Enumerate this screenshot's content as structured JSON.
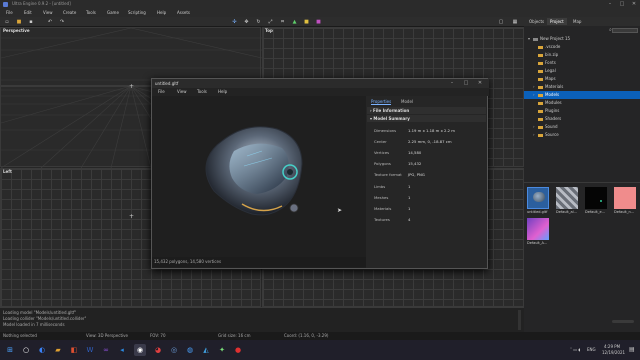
{
  "app": {
    "title": "Ultra Engine 0.9.2 - [untitled]"
  },
  "menu": [
    "File",
    "Edit",
    "View",
    "Create",
    "Tools",
    "Game",
    "Scripting",
    "Help",
    "Assets"
  ],
  "viewports": {
    "perspective": "Perspective",
    "top": "Top",
    "left": "Left"
  },
  "console": {
    "lines": [
      "Loading model \"Models/untitled.gltf\"",
      "Loading collider \"Models/untitled.collider\"",
      "Model loaded in 7 milliseconds"
    ]
  },
  "statusbar": {
    "selection": "Nothing selected",
    "view": "View: 3D Perspective",
    "fov": "FOV: 70",
    "grid": "Grid size: 16 cm",
    "coords": "Coord: (1.16, 0, -3.29)"
  },
  "right_panel": {
    "tabs": [
      "Objects",
      "Project",
      "Map"
    ],
    "active_tab": "Project",
    "tree": [
      {
        "label": "New Project 15",
        "expanded": true,
        "level": 0
      },
      {
        "label": ".vscode",
        "level": 1
      },
      {
        "label": "bin.zip",
        "level": 1
      },
      {
        "label": "Fonts",
        "level": 1
      },
      {
        "label": "Legal",
        "level": 1
      },
      {
        "label": "Maps",
        "level": 1
      },
      {
        "label": "Materials",
        "level": 1,
        "arrow": true
      },
      {
        "label": "Models",
        "level": 1,
        "arrow": true,
        "selected": true
      },
      {
        "label": "Modules",
        "level": 1
      },
      {
        "label": "Plugins",
        "level": 1
      },
      {
        "label": "Shaders",
        "level": 1
      },
      {
        "label": "Sound",
        "level": 1,
        "arrow": true
      },
      {
        "label": "Source",
        "level": 1,
        "arrow": true
      }
    ],
    "assets": [
      {
        "label": "untitled.gltf",
        "color": "#2b5f9e",
        "selected": true
      },
      {
        "label": "Default_al...",
        "color": "#9aa0aa"
      },
      {
        "label": "Default_e...",
        "color": "#050505"
      },
      {
        "label": "Default_n...",
        "color": "#f08c8c"
      },
      {
        "label": "Default_A...",
        "color": "#b05bd6"
      }
    ]
  },
  "dialog": {
    "title": "untitled.gltf",
    "menu": [
      "File",
      "View",
      "Tools",
      "Help"
    ],
    "tabs": [
      "Properties",
      "Model"
    ],
    "active_tab": "Properties",
    "sections": {
      "file_info": "File Information",
      "model_summary": "Model Summary"
    },
    "properties": [
      {
        "label": "Dimensions",
        "value": "1.19 m x 1.18 m x 2.2 m"
      },
      {
        "label": "Center",
        "value": "2.25 mm, 0, -18.87 cm"
      },
      {
        "label": "Vertices",
        "value": "14,580"
      },
      {
        "label": "Polygons",
        "value": "15,432"
      },
      {
        "label": "Texture format",
        "value": "JPG, PNG"
      },
      {
        "label": "Limbs",
        "value": "1"
      },
      {
        "label": "Meshes",
        "value": "1"
      },
      {
        "label": "Materials",
        "value": "1"
      },
      {
        "label": "Textures",
        "value": "4"
      }
    ],
    "preview_status": "15,432 polygons, 14,580 vertices"
  },
  "taskbar": {
    "time": "4:29 PM",
    "date": "12/19/2021",
    "lang": "ENG"
  },
  "colors": {
    "accent": "#0b60b9",
    "folder": "#d9a53a",
    "bg": "#1e1e1e"
  }
}
